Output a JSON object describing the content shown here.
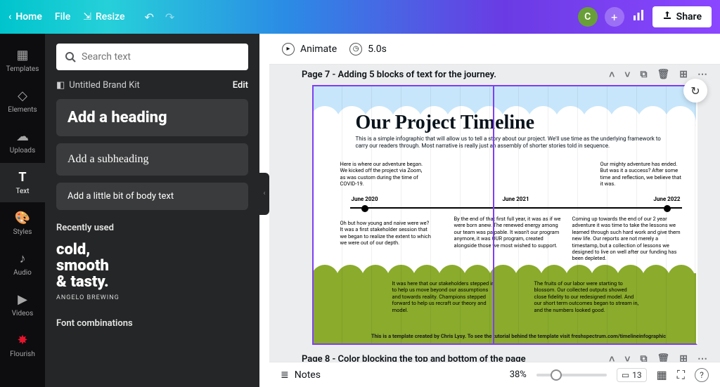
{
  "topbar": {
    "home": "Home",
    "file": "File",
    "resize": "Resize",
    "share": "Share",
    "avatar_letter": "C"
  },
  "rail": {
    "templates": "Templates",
    "elements": "Elements",
    "uploads": "Uploads",
    "text": "Text",
    "styles": "Styles",
    "audio": "Audio",
    "videos": "Videos",
    "flourish": "Flourish"
  },
  "panel": {
    "search_placeholder": "Search text",
    "brandkit": "Untitled Brand Kit",
    "edit": "Edit",
    "add_heading": "Add a heading",
    "add_subheading": "Add a subheading",
    "add_body": "Add a little bit of body text",
    "recently_used": "Recently used",
    "sample": {
      "l1": "cold,",
      "l2": "smooth",
      "l3": "& tasty.",
      "sub": "ANGELO BREWING"
    },
    "font_combinations": "Font combinations"
  },
  "editor": {
    "animate": "Animate",
    "duration": "5.0s",
    "page7_title": "Page 7 - Adding 5 blocks of text for the journey.",
    "page8_title": "Page 8 - Color blocking the top and bottom of the page",
    "notes": "Notes",
    "zoom": "38%",
    "page_number": "13"
  },
  "canvas": {
    "title": "Our Project Timeline",
    "desc": "This is a simple infographic that will allow us to tell a story about our project.  We'll use time as the underlying framework to carry our readers through.  Most narrative is really just an assembly of shorter stories told in sequence.",
    "dates": {
      "d1": "June 2020",
      "d2": "June 2021",
      "d3": "June 2022"
    },
    "b1": "Here is  where our adventure began.  We kicked off the project via Zoom, as was custom during the time of COVID-19.",
    "b2": "Our mighty adventure has ended.  But was it a success?  After some time and reflection, we believe that it was.",
    "b3": "Oh  but how young and naive were we?  It was a first stakeholder session that we began to realize the extent to which we were out of our depth.",
    "b4": "By the end of that first full year, it was as if we were born anew.  The renewed energy among our team was palpable.  It wasn't our program anymore, it was OUR program, created alongside those we most wished to support.",
    "b5": "Coming up towards the end of our 2 year adventure it was time to take the lessons we learned through such hard work and give them new life.  Our reports are not merely a timestamp, but a collection of lessons we designed to live on well after our funding has been depleted.",
    "b6": "It was here that our stakeholders stepped in to help us move beyond our assumptions and towards reality.  Champions stepped forward to help us recraft our theory and model.",
    "b7": "The fruits of our labor were starting to blossom.  Our collected outputs showed close fidelity to our redesigned model.  And our short term outcomes began to stream in, and the numbers looked good.",
    "footer": "This is a template created by Chris Lysy.  To see the tutorial behind the template visit freshspectrum.com/timelineinfographic"
  }
}
